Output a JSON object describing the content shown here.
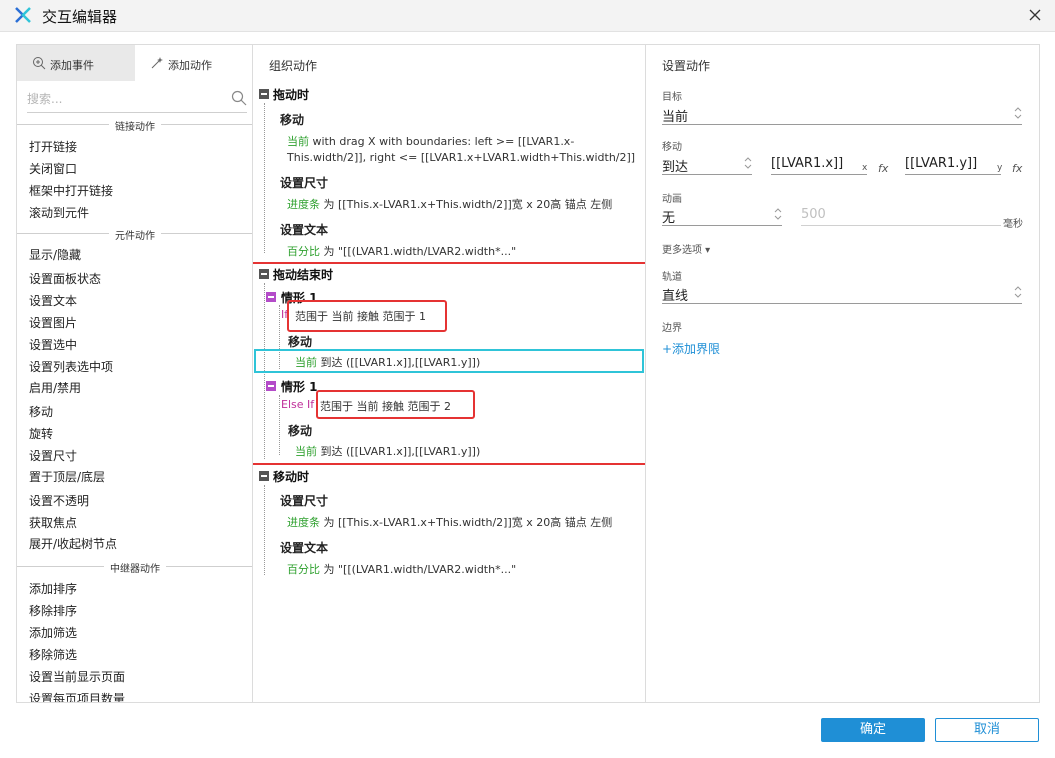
{
  "window": {
    "title": "交互编辑器"
  },
  "left": {
    "tabs": [
      {
        "label": "添加事件"
      },
      {
        "label": "添加动作"
      }
    ],
    "search_placeholder": "搜索...",
    "sections": [
      {
        "title": "链接动作",
        "items": [
          "打开链接",
          "关闭窗口",
          "框架中打开链接",
          "滚动到元件"
        ]
      },
      {
        "title": "元件动作",
        "items": [
          "显示/隐藏",
          "设置面板状态",
          "设置文本",
          "设置图片",
          "设置选中",
          "设置列表选中项",
          "启用/禁用",
          "移动",
          "旋转",
          "设置尺寸",
          "置于顶层/底层",
          "设置不透明",
          "获取焦点",
          "展开/收起树节点"
        ]
      },
      {
        "title": "中继器动作",
        "items": [
          "添加排序",
          "移除排序",
          "添加筛选",
          "移除筛选",
          "设置当前显示页面",
          "设置每页项目数量"
        ]
      }
    ]
  },
  "middle": {
    "heading": "组织动作",
    "drag": {
      "event": "拖动时",
      "move_title": "移动",
      "move_target": "当前",
      "move_line1": " with drag X  with boundaries: left >= [[LVAR1.x-",
      "move_line2": "This.width/2]], right <= [[LVAR1.x+LVAR1.width+This.width/2]]",
      "size_title": "设置尺寸",
      "size_target": "进度条",
      "size_text": " 为 [[This.x-LVAR1.x+This.width/2]]宽 x 20高  锚点 左侧",
      "text_title": "设置文本",
      "text_target": "百分比",
      "text_text": " 为 \"[[(LVAR1.width/LVAR2.width*...\""
    },
    "drag_end": {
      "event": "拖动结束时",
      "case1_label": "情形 1",
      "case1_prefix": "If",
      "case1_condition": "范围于 当前 接触  范围于 1",
      "case1_move_title": "移动",
      "case1_target": "当前",
      "case1_move_text": " 到达 ([[LVAR1.x]],[[LVAR1.y]])",
      "case2_label": "情形 1",
      "case2_prefix": "Else If",
      "case2_condition": "范围于 当前 接触  范围于 2",
      "case2_move_title": "移动",
      "case2_target": "当前",
      "case2_move_text": " 到达 ([[LVAR1.x]],[[LVAR1.y]])"
    },
    "moving": {
      "event": "移动时",
      "size_title": "设置尺寸",
      "size_target": "进度条",
      "size_text": " 为 [[This.x-LVAR1.x+This.width/2]]宽 x 20高  锚点 左侧",
      "text_title": "设置文本",
      "text_target": "百分比",
      "text_text": " 为 \"[[(LVAR1.width/LVAR2.width*...\""
    }
  },
  "right": {
    "heading": "设置动作",
    "target_label": "目标",
    "target_value": "当前",
    "move_label": "移动",
    "move_value": "到达",
    "x_value": "[[LVAR1.x]]",
    "x_sub": "x",
    "y_value": "[[LVAR1.y]]",
    "y_sub": "y",
    "fx": "fx",
    "anim_label": "动画",
    "anim_value": "无",
    "duration_value": "500",
    "duration_unit": "毫秒",
    "more_options": "更多选项 ▾",
    "track_label": "轨道",
    "track_value": "直线",
    "bounds_label": "边界",
    "add_bounds": "+添加界限"
  },
  "footer": {
    "ok": "确定",
    "cancel": "取消"
  },
  "colors": {
    "accent": "#1f8fd6",
    "highlight_red": "#e53333",
    "highlight_cyan": "#2fc4d8",
    "action_target": "#2ea02e",
    "else_if": "#c0309a"
  }
}
